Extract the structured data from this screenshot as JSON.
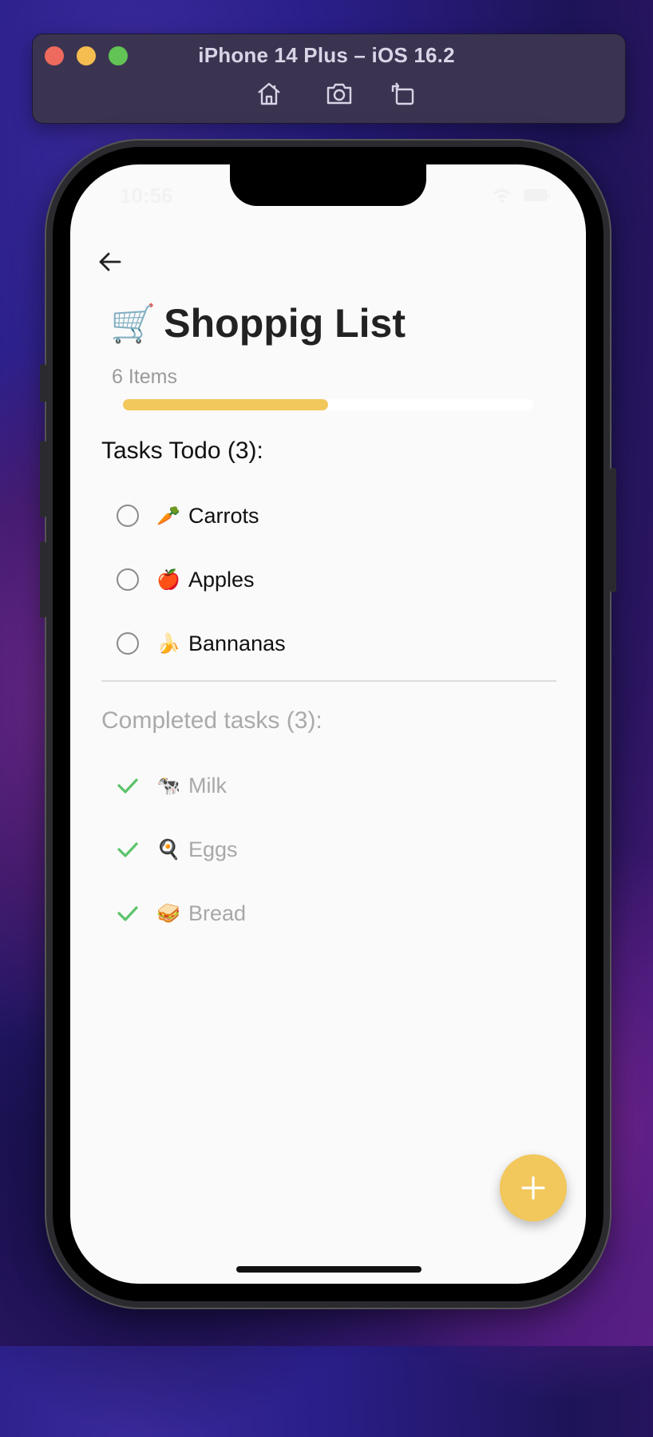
{
  "simulator": {
    "title": "iPhone 14 Plus – iOS 16.2",
    "toolbar_icons": [
      "home-icon",
      "screenshot-icon",
      "rotate-icon"
    ]
  },
  "status_bar": {
    "time": "10:56"
  },
  "header": {
    "title_emoji": "🛒",
    "title": "Shoppig List",
    "items_count": "6 Items",
    "progress": 0.5
  },
  "todo": {
    "heading": "Tasks Todo (3):",
    "items": [
      {
        "emoji": "🥕",
        "label": "Carrots"
      },
      {
        "emoji": "🍎",
        "label": "Apples"
      },
      {
        "emoji": "🍌",
        "label": "Bannanas"
      }
    ]
  },
  "completed": {
    "heading": "Completed tasks (3):",
    "items": [
      {
        "emoji": "🐄",
        "label": "Milk"
      },
      {
        "emoji": "🍳",
        "label": "Eggs"
      },
      {
        "emoji": "🥪",
        "label": "Bread"
      }
    ]
  },
  "colors": {
    "accent": "#f2c75b",
    "check": "#5cc36a"
  }
}
